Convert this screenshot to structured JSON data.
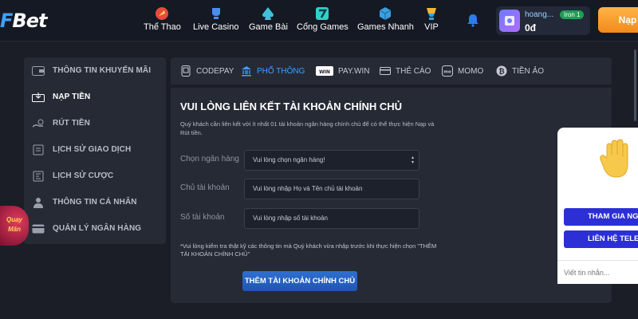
{
  "brand": {
    "logo_text": "Bet",
    "accent": "#3da1ff",
    "deposit_color": "#f28a1b"
  },
  "nav": [
    {
      "label": "Thể Thao",
      "icon": "rocket-icon"
    },
    {
      "label": "Live Casino",
      "icon": "trophy-icon"
    },
    {
      "label": "Game Bài",
      "icon": "spade-icon"
    },
    {
      "label": "Cổng Games",
      "icon": "seven-icon"
    },
    {
      "label": "Games Nhanh",
      "icon": "cube-icon"
    },
    {
      "label": "VIP",
      "icon": "cup-icon"
    }
  ],
  "user": {
    "name": "hoang...",
    "balance": "0đ",
    "rank": "Iron 1"
  },
  "header": {
    "deposit_label": "Nạp"
  },
  "sidebar": {
    "items": [
      {
        "label": "THÔNG TIN KHUYẾN MÃI",
        "icon": "wallet-icon"
      },
      {
        "label": "NẠP TIỀN",
        "icon": "cash-deposit-icon",
        "active": true
      },
      {
        "label": "RÚT TIỀN",
        "icon": "cash-withdraw-icon"
      },
      {
        "label": "LỊCH SỬ GIAO DỊCH",
        "icon": "history-icon"
      },
      {
        "label": "LỊCH SỬ CƯỢC",
        "icon": "bet-history-icon"
      },
      {
        "label": "THÔNG TIN CÁ NHÂN",
        "icon": "user-icon"
      },
      {
        "label": "QUẢN LÝ NGÂN HÀNG",
        "icon": "bank-card-icon"
      }
    ],
    "promo_badge": "Quay\nMăn"
  },
  "tabs": [
    {
      "label": "CODEPAY",
      "icon": "phone-icon"
    },
    {
      "label": "PHỔ THÔNG",
      "icon": "bank-icon",
      "active": true
    },
    {
      "label": "PAY.WIN",
      "icon": "paywin-icon"
    },
    {
      "label": "THẺ CÀO",
      "icon": "card-icon"
    },
    {
      "label": "MOMO",
      "icon": "momo-icon"
    },
    {
      "label": "TIỀN ẢO",
      "icon": "bitcoin-icon"
    }
  ],
  "form": {
    "title": "VUI LÒNG LIÊN KẾT TÀI KHOẢN CHÍNH CHỦ",
    "description": "Quý khách cần liên kết với ít nhất 01 tài khoản ngân hàng chính chủ để có thể thực hiện Nạp và Rút tiền.",
    "bank_label": "Chọn ngân hàng",
    "bank_value": "Vui lòng chọn ngân hàng!",
    "owner_label": "Chủ tài khoản",
    "owner_placeholder": "Vui lòng nhập Họ và Tên chủ tài khoản",
    "account_label": "Số tài khoản",
    "account_placeholder": "Vui lòng nhập số tài khoản",
    "note": "*Vui lòng kiểm tra thật kỹ các thông tin mà Quý khách vừa nhập trước khi thực hiện chọn \"THÊM TÀI KHOẢN CHÍNH CHỦ\"",
    "submit_label": "THÊM TÀI KHOẢN CHÍNH CHỦ"
  },
  "chat": {
    "join_label": "THAM GIA NG",
    "contact_label": "LIÊN HỆ TELEGR",
    "input_placeholder": "Viết tin nhắn..."
  }
}
